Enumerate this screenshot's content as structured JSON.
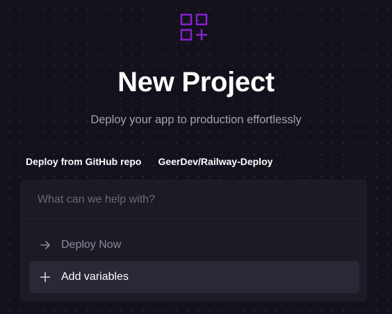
{
  "colors": {
    "background": "#13111c",
    "accent": "#8a1fd1",
    "card": "#1b1a25",
    "highlight": "#2a2835"
  },
  "logo": {
    "icon": "grid-plus-icon"
  },
  "header": {
    "title": "New Project",
    "subtitle": "Deploy your app to production effortlessly"
  },
  "meta": {
    "source_label": "Deploy from GitHub repo",
    "repo_name": "GeerDev/Railway-Deploy"
  },
  "prompt": {
    "placeholder": "What can we help with?",
    "value": ""
  },
  "actions": [
    {
      "label": "Deploy Now",
      "icon": "arrow-right-icon"
    },
    {
      "label": "Add variables",
      "icon": "plus-icon"
    }
  ]
}
